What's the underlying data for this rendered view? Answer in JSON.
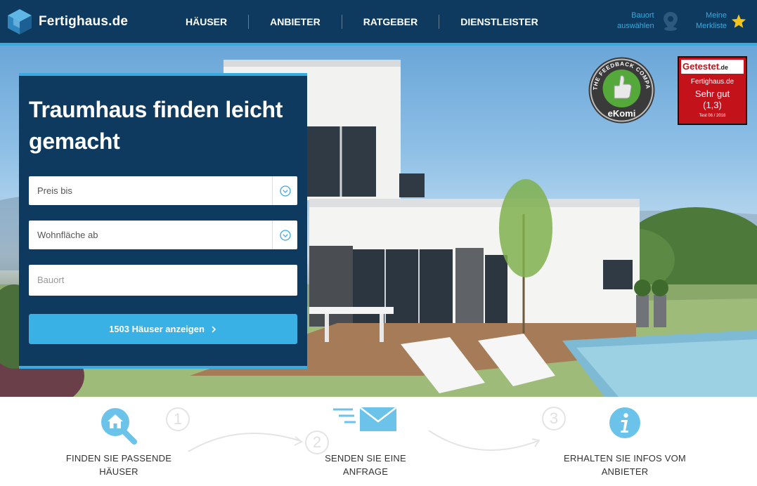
{
  "header": {
    "logo_text": "Fertighaus.de",
    "nav": [
      "HÄUSER",
      "ANBIETER",
      "RATGEBER",
      "DIENSTLEISTER"
    ],
    "bauort_line1": "Bauort",
    "bauort_line2": "auswählen",
    "merkliste_line1": "Meine",
    "merkliste_line2": "Merkliste"
  },
  "search": {
    "title_line1": "Traumhaus finden leicht",
    "title_line2": "gemacht",
    "preis_label": "Preis bis",
    "wohnflaeche_label": "Wohnfläche ab",
    "bauort_placeholder": "Bauort",
    "submit_label": "1503 Häuser anzeigen"
  },
  "badges": {
    "ekomi_ring": "THE FEEDBACK COMPANY",
    "ekomi_brand": "eKomi",
    "getestet_brand": "Getestet",
    "getestet_tld": ".de",
    "getestet_site": "Fertighaus.de",
    "getestet_rating": "Sehr gut",
    "getestet_score": "(1,3)",
    "getestet_date": "Test 06 / 2016"
  },
  "steps": [
    {
      "number": "1",
      "line1": "FINDEN SIE PASSENDE",
      "line2": "HÄUSER",
      "icon": "house-search-icon"
    },
    {
      "number": "2",
      "line1": "SENDEN SIE EINE",
      "line2": "ANFRAGE",
      "icon": "envelope-send-icon"
    },
    {
      "number": "3",
      "line1": "ERHALTEN SIE INFOS VOM",
      "line2": "ANBIETER",
      "icon": "info-icon"
    }
  ],
  "colors": {
    "navy": "#0d3a5e",
    "accent": "#3aa9dd",
    "button": "#3ab1e4",
    "star": "#f5c518",
    "badge_red": "#c4121a"
  }
}
